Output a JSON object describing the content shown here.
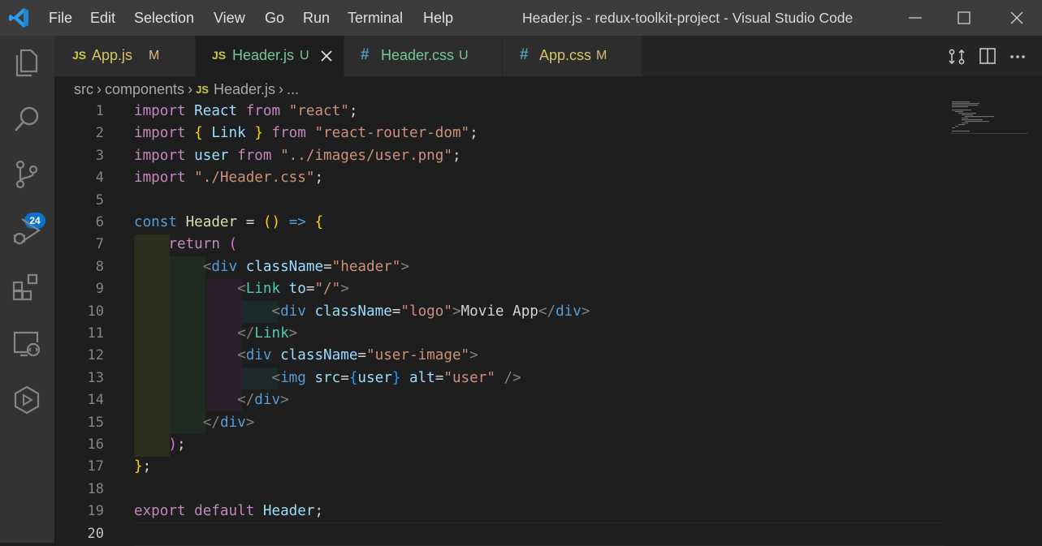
{
  "window": {
    "title": "Header.js - redux-toolkit-project - Visual Studio Code",
    "menu": [
      "File",
      "Edit",
      "Selection",
      "View",
      "Go",
      "Run",
      "Terminal",
      "Help"
    ]
  },
  "activity_bar": {
    "items": [
      "explorer-icon",
      "search-icon",
      "source-control-icon",
      "run-debug-icon",
      "extensions-icon",
      "remote-explorer-icon",
      "extension-panel-icon"
    ],
    "source_control_badge": "24"
  },
  "tabs": [
    {
      "type": "JS",
      "name": "App.js",
      "status": "M",
      "active": false
    },
    {
      "type": "JS",
      "name": "Header.js",
      "status": "U",
      "active": true
    },
    {
      "type": "#",
      "name": "Header.css",
      "status": "U",
      "active": false
    },
    {
      "type": "#",
      "name": "App.css",
      "status": "M",
      "active": false
    }
  ],
  "breadcrumb": {
    "parts": [
      "src",
      "components"
    ],
    "file_type": "JS",
    "file": "Header.js",
    "ellipsis": "..."
  },
  "editor": {
    "current_line": 20,
    "line_numbers": [
      "1",
      "2",
      "3",
      "4",
      "5",
      "6",
      "7",
      "8",
      "9",
      "10",
      "11",
      "12",
      "13",
      "14",
      "15",
      "16",
      "17",
      "18",
      "19",
      "20"
    ],
    "lines": [
      "import React from \"react\";",
      "import { Link } from \"react-router-dom\";",
      "import user from \"../images/user.png\";",
      "import \"./Header.css\";",
      "",
      "const Header = () => {",
      "    return (",
      "        <div className=\"header\">",
      "            <Link to=\"/\">",
      "                <div className=\"logo\">Movie App</div>",
      "            </Link>",
      "            <div className=\"user-image\">",
      "                <img src={user} alt=\"user\" />",
      "            </div>",
      "        </div>",
      "    );",
      "};",
      "",
      "export default Header;",
      ""
    ]
  },
  "colors": {
    "title_bar": "#3c3c3c",
    "activity_bar": "#333333",
    "editor_bg": "#1e1e1e",
    "badge": "#0e73c8",
    "keyword": "#c586c0",
    "string": "#ce9178",
    "variable": "#9cdcfe",
    "tag": "#569cd6"
  }
}
